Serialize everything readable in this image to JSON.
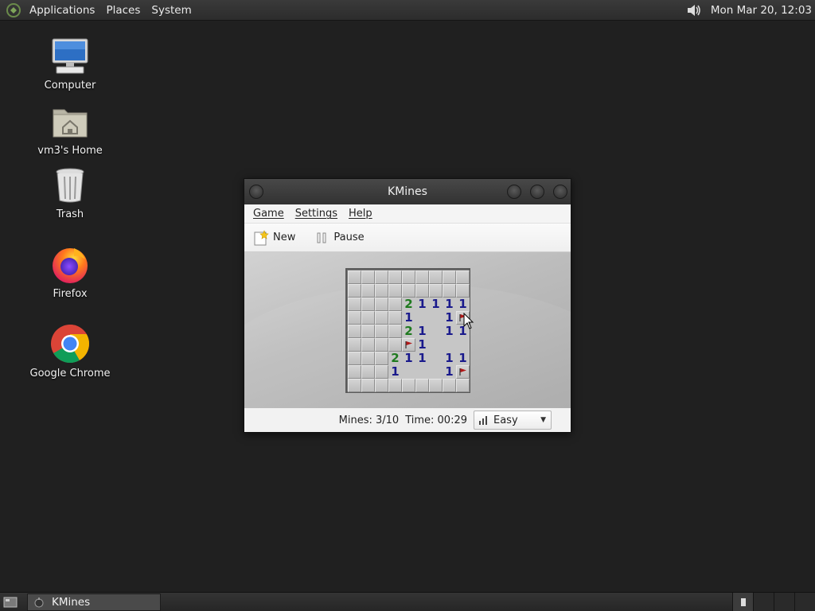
{
  "top_panel": {
    "menus": [
      "Applications",
      "Places",
      "System"
    ],
    "clock": "Mon Mar 20, 12:03"
  },
  "desktop": {
    "icons": [
      {
        "label": "Computer",
        "icon": "computer-icon"
      },
      {
        "label": "vm3's Home",
        "icon": "home-folder-icon"
      },
      {
        "label": "Trash",
        "icon": "trash-icon"
      },
      {
        "label": "Firefox",
        "icon": "firefox-icon"
      },
      {
        "label": "Google Chrome",
        "icon": "chrome-icon"
      }
    ]
  },
  "window": {
    "title": "KMines",
    "menus": [
      "Game",
      "Settings",
      "Help"
    ],
    "toolbar": {
      "new_label": "New",
      "pause_label": "Pause"
    },
    "status": {
      "mines": "Mines: 3/10",
      "time": "Time: 00:29",
      "difficulty": "Easy"
    }
  },
  "board": {
    "legend": "H = unrevealed, E = revealed empty, F = flagged, digit = revealed count",
    "rows": [
      [
        "H",
        "H",
        "H",
        "H",
        "H",
        "H",
        "H",
        "H",
        "H"
      ],
      [
        "H",
        "H",
        "H",
        "H",
        "H",
        "H",
        "H",
        "H",
        "H"
      ],
      [
        "H",
        "H",
        "H",
        "H",
        "2",
        "1",
        "1",
        "1",
        "1"
      ],
      [
        "H",
        "H",
        "H",
        "H",
        "1",
        "E",
        "E",
        "1",
        "F"
      ],
      [
        "H",
        "H",
        "H",
        "H",
        "2",
        "1",
        "E",
        "1",
        "1"
      ],
      [
        "H",
        "H",
        "H",
        "H",
        "F",
        "1",
        "E",
        "E",
        "E"
      ],
      [
        "H",
        "H",
        "H",
        "2",
        "1",
        "1",
        "E",
        "1",
        "1"
      ],
      [
        "H",
        "H",
        "H",
        "1",
        "E",
        "E",
        "E",
        "1",
        "F"
      ],
      [
        "H",
        "H",
        "H",
        "H",
        "H",
        "H",
        "H",
        "H",
        "H"
      ]
    ]
  },
  "taskbar": {
    "task_label": "KMines"
  },
  "colors": {
    "num1": "#1a1a8c",
    "num2": "#1f7a1f",
    "flag": "#b01818"
  }
}
